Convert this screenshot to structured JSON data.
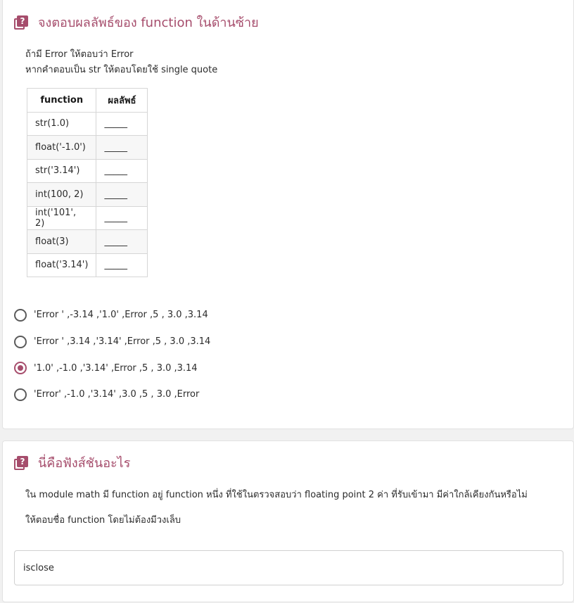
{
  "question1": {
    "title": "จงตอบผลลัพธ์ของ function ในด้านซ้าย",
    "instructions": [
      "ถ้ามี Error ให้ตอบว่า Error",
      "หากคำตอบเป็น str ให้ตอบโดยใช้ single quote"
    ],
    "table": {
      "headers": [
        "function",
        "ผลลัพธ์"
      ],
      "rows": [
        [
          "str(1.0)",
          "_____"
        ],
        [
          "float('-1.0')",
          "_____"
        ],
        [
          "str('3.14')",
          "_____"
        ],
        [
          "int(100, 2)",
          "_____"
        ],
        [
          "int('101', 2)",
          "_____"
        ],
        [
          "float(3)",
          "_____"
        ],
        [
          "float('3.14')",
          "_____"
        ]
      ]
    },
    "options": [
      {
        "label": "'Error ' ,-3.14 ,'1.0' ,Error ,5 , 3.0 ,3.14",
        "selected": false
      },
      {
        "label": "'Error ' ,3.14 ,'3.14' ,Error ,5 , 3.0 ,3.14",
        "selected": false
      },
      {
        "label": "'1.0' ,-1.0 ,'3.14' ,Error ,5 , 3.0 ,3.14",
        "selected": true
      },
      {
        "label": "'Error' ,-1.0 ,'3.14' ,3.0 ,5 , 3.0 ,Error",
        "selected": false
      }
    ]
  },
  "question2": {
    "title": "นี่คือฟังส์ชันอะไร",
    "line1": "ใน module math มี function อยู่ function หนึ่ง ที่ใช้ในตรวจสอบว่า floating point 2 ค่า ที่รับเข้ามา มีค่าใกล้เคียงกันหรือไม่",
    "line2": "ให้ตอบชื่อ function โดยไม่ต้องมีวงเล็บ",
    "answer_value": "isclose"
  },
  "icon": {
    "name": "question-icon",
    "glyph": "?"
  },
  "colors": {
    "accent": "#a64d6c"
  }
}
